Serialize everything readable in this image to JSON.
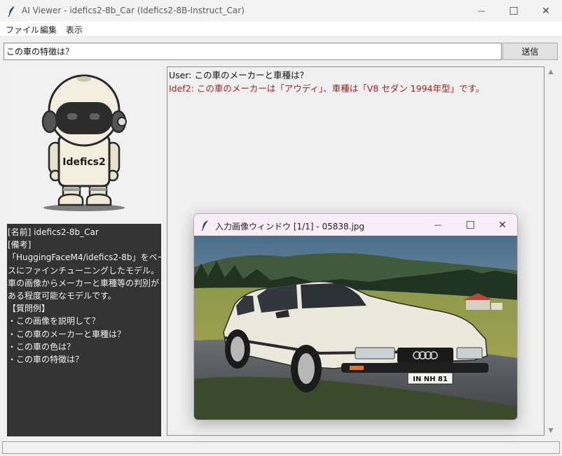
{
  "window": {
    "title": "AI Viewer - idefics2-8b_Car (Idefics2-8B-Instruct_Car)",
    "minimize_glyph": "—",
    "maximize_glyph": "☐",
    "close_glyph": "✕"
  },
  "menu": {
    "items": [
      {
        "label": "ファイル"
      },
      {
        "label": "編集"
      },
      {
        "label": "表示"
      }
    ]
  },
  "query": {
    "value": "この車の特徴は？",
    "send_label": "送信"
  },
  "avatar": {
    "icon": "robot-mascot-icon",
    "shirt_text": "Idefics2"
  },
  "info": {
    "lines": [
      "[名前] idefics2-8b_Car",
      "[備考]",
      "「HuggingFaceM4/idefics2-8b」をベー",
      "スにファインチューニングしたモデル。",
      "車の画像からメーカーと車種等の判別が",
      "ある程度可能なモデルです。",
      "【質問例】",
      "・この画像を説明して？",
      "・この車のメーカーと車種は？",
      "・この車の色は？",
      "・この車の特徴は？"
    ]
  },
  "chat": {
    "messages": [
      {
        "role": "user",
        "text": "User: この車のメーカーと車種は？"
      },
      {
        "role": "bot",
        "text": "Idef2: この車のメーカーは「アウディ」、車種は「V8 セダン 1994年型」です。"
      }
    ]
  },
  "image_window": {
    "title": "入力画像ウィンドウ [1/1] - 05838.jpg",
    "minimize_glyph": "—",
    "maximize_glyph": "☐",
    "close_glyph": "✕",
    "photo": {
      "icon": "car-photo-icon",
      "plate_text": "IN NH 81"
    }
  },
  "colors": {
    "bot_text": "#9b2222",
    "info_bg": "#333333",
    "car_body": "#ebe8dc"
  }
}
